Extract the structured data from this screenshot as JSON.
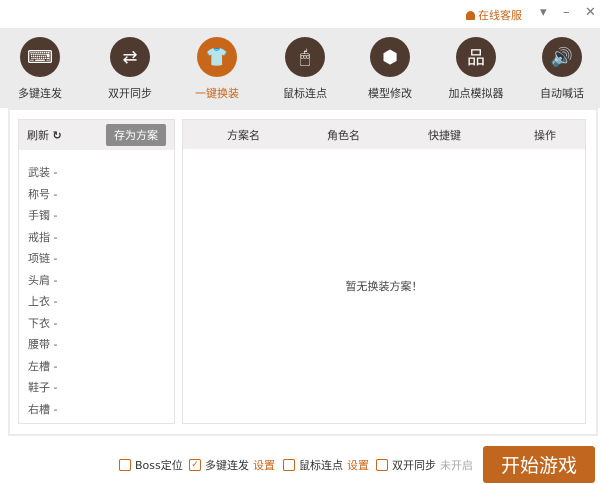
{
  "header": {
    "service": "在线客服",
    "menu_icon": "▾",
    "min_icon": "–",
    "close_icon": "✕"
  },
  "tools": [
    {
      "label": "多键连发",
      "icon": "⌨",
      "active": false
    },
    {
      "label": "双开同步",
      "icon": "⇄",
      "active": false
    },
    {
      "label": "一键换装",
      "icon": "👕",
      "active": true
    },
    {
      "label": "鼠标连点",
      "icon": "🖱",
      "active": false
    },
    {
      "label": "模型修改",
      "icon": "⬢",
      "active": false
    },
    {
      "label": "加点模拟器",
      "icon": "品",
      "active": false
    },
    {
      "label": "自动喊话",
      "icon": "🔊",
      "active": false
    }
  ],
  "left": {
    "refresh": "刷新",
    "refresh_icon": "↻",
    "save": "存为方案",
    "items": [
      "武装 -",
      "称号 -",
      "手镯 -",
      "戒指 -",
      "项链 -",
      "头肩 -",
      "上衣 -",
      "下衣 -",
      "腰带 -",
      "左槽 -",
      "鞋子 -",
      "右槽 -"
    ]
  },
  "table": {
    "columns": [
      "方案名",
      "角色名",
      "快捷键",
      "操作"
    ],
    "empty": "暂无换装方案！"
  },
  "bottom": {
    "boss": "Boss定位",
    "multi": "多键连发",
    "multi_set": "设置",
    "mouse": "鼠标连点",
    "mouse_set": "设置",
    "dual": "双开同步",
    "dual_status": "未开启",
    "check": "✓",
    "start": "开始游戏"
  },
  "colors": {
    "accent": "#c8661a",
    "icon_bg": "#4e3a2e"
  }
}
